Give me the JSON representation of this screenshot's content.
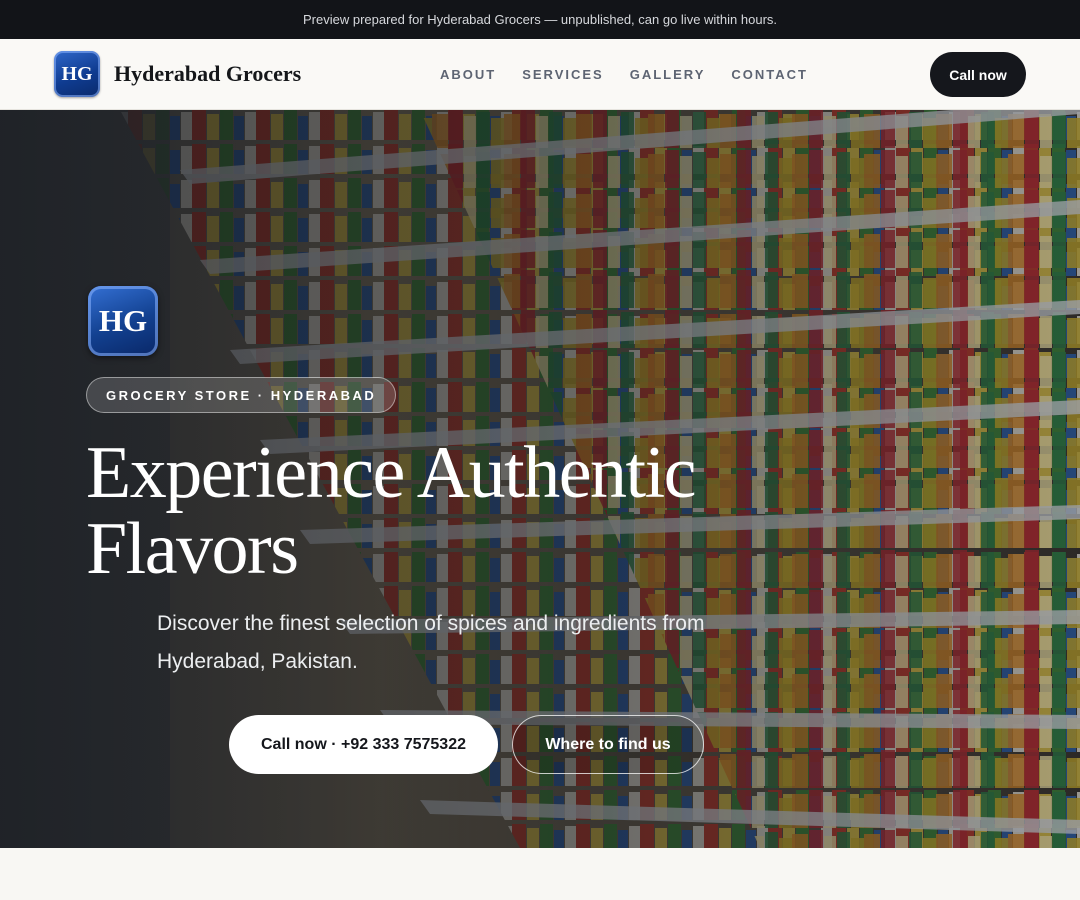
{
  "announcement": "Preview prepared for Hyderabad Grocers — unpublished, can go live within hours.",
  "brand": {
    "logo_text": "HG",
    "name": "Hyderabad Grocers"
  },
  "nav": {
    "links": [
      "ABOUT",
      "SERVICES",
      "GALLERY",
      "CONTACT"
    ],
    "cta_label": "Call now"
  },
  "hero": {
    "logo_text": "HG",
    "badge": "GROCERY STORE · HYDERABAD",
    "headline_line1": "Experience Authentic",
    "headline_line2": "Flavors",
    "subhead": "Discover the finest selection of spices and ingredients from Hyderabad, Pakistan.",
    "primary_button": "Call now · +92 333 7575322",
    "secondary_button": "Where to find us",
    "background_icon": "supermarket-shelves-photo"
  },
  "colors": {
    "topbar": "#121418",
    "brand_blue": "#12408f",
    "cta_dark": "#15171c",
    "page_background": "#f8f7f3"
  }
}
